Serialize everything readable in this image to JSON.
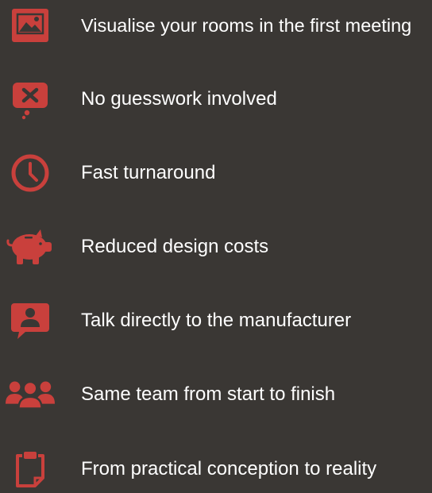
{
  "accent_color": "#c9403c",
  "background_color": "#3a3734",
  "features": [
    {
      "icon": "image-icon",
      "label": "Visualise your rooms in the first meeting"
    },
    {
      "icon": "speech-bubble-x-icon",
      "label": "No guesswork involved"
    },
    {
      "icon": "clock-icon",
      "label": "Fast turnaround"
    },
    {
      "icon": "piggy-bank-icon",
      "label": "Reduced design costs"
    },
    {
      "icon": "person-chat-icon",
      "label": "Talk directly to the manufacturer"
    },
    {
      "icon": "team-icon",
      "label": "Same team from start to finish"
    },
    {
      "icon": "clipboard-icon",
      "label": "From practical conception to reality"
    }
  ]
}
